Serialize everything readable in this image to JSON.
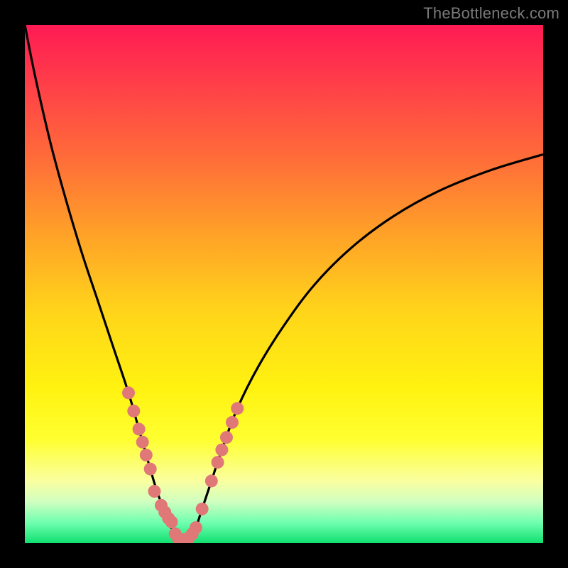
{
  "watermark": "TheBottleneck.com",
  "chart_data": {
    "type": "line",
    "title": "",
    "xlabel": "",
    "ylabel": "",
    "xlim": [
      0,
      100
    ],
    "ylim": [
      0,
      100
    ],
    "grid": false,
    "legend": false,
    "series": [
      {
        "name": "bottleneck-curve",
        "x": [
          0,
          2,
          5,
          8,
          11,
          14,
          17,
          20,
          22,
          24,
          25.5,
          27,
          28,
          29,
          30,
          31,
          32,
          33,
          34,
          36,
          38,
          41,
          45,
          50,
          56,
          63,
          71,
          80,
          90,
          100
        ],
        "y": [
          100,
          90,
          77,
          66,
          56,
          47,
          38,
          29,
          22,
          15,
          10,
          6,
          3.5,
          1.8,
          0.6,
          0.6,
          1.2,
          3,
          6,
          12,
          18,
          26,
          34,
          42,
          50,
          57,
          63,
          68,
          72,
          75
        ]
      }
    ],
    "dots": {
      "name": "highlighted-points",
      "left_branch_x": [
        20.0,
        21.0,
        22.0,
        22.7,
        23.4,
        24.2,
        25.0,
        26.3,
        27.0,
        27.7,
        28.3,
        29.0
      ],
      "left_branch_y": [
        29.0,
        25.5,
        22.0,
        19.5,
        17.0,
        14.3,
        10.0,
        7.3,
        6.0,
        4.8,
        4.1,
        1.8
      ],
      "bottom_x": [
        29.6,
        30.2,
        30.8
      ],
      "bottom_y": [
        0.9,
        0.6,
        0.7
      ],
      "right_branch_x": [
        31.6,
        32.3,
        33.0,
        34.2,
        36.0,
        37.2,
        38.0,
        38.9,
        40.0,
        41.0
      ],
      "right_branch_y": [
        1.0,
        1.8,
        3.0,
        6.6,
        12.0,
        15.6,
        18.0,
        20.4,
        23.3,
        26.0
      ]
    },
    "gradient_stops": [
      {
        "pos": 0,
        "color": "#ff1a54"
      },
      {
        "pos": 10,
        "color": "#ff3a4a"
      },
      {
        "pos": 25,
        "color": "#ff6a3a"
      },
      {
        "pos": 40,
        "color": "#ffa028"
      },
      {
        "pos": 55,
        "color": "#ffd41a"
      },
      {
        "pos": 70,
        "color": "#fff210"
      },
      {
        "pos": 80,
        "color": "#ffff30"
      },
      {
        "pos": 88,
        "color": "#faffa0"
      },
      {
        "pos": 92,
        "color": "#d0ffc0"
      },
      {
        "pos": 96,
        "color": "#70ffb0"
      },
      {
        "pos": 100,
        "color": "#10e070"
      }
    ]
  }
}
